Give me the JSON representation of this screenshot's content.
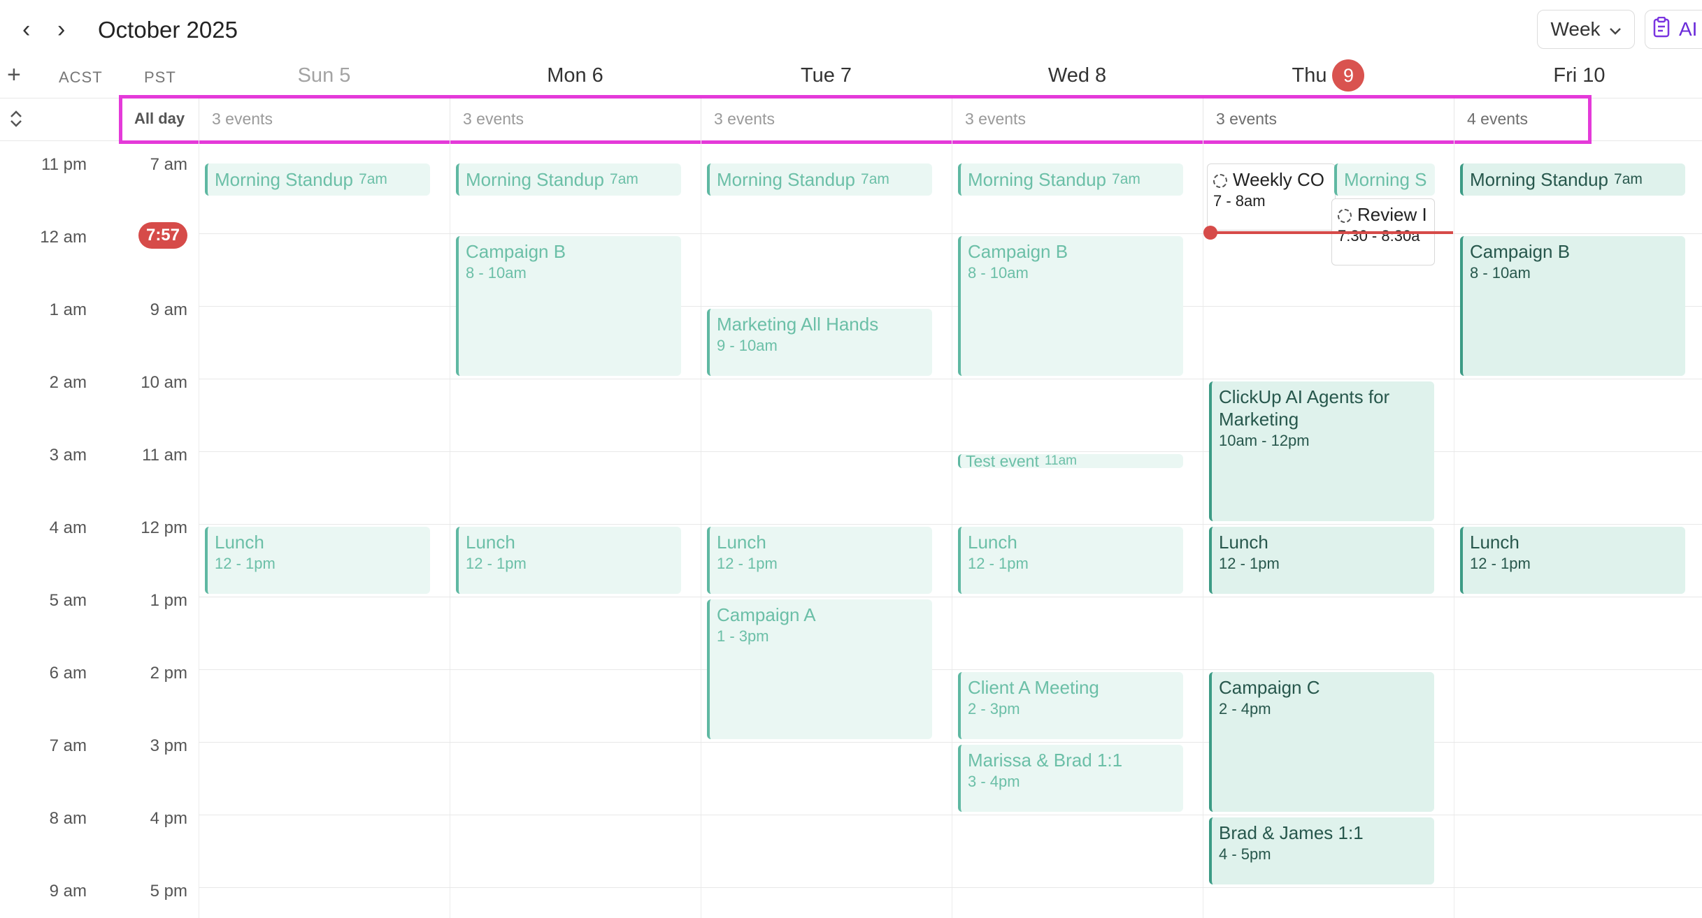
{
  "toolbar": {
    "prev_label": "‹",
    "next_label": "›",
    "month_title": "October 2025",
    "view_label": "Week",
    "ai_label": "AI"
  },
  "timezones": {
    "add_label": "+",
    "primary": "ACST",
    "secondary": "PST"
  },
  "days": [
    {
      "label": "Sun 5",
      "state": "past",
      "allday": "3 events"
    },
    {
      "label": "Mon 6",
      "state": "normal",
      "allday": "3 events"
    },
    {
      "label": "Tue 7",
      "state": "normal",
      "allday": "3 events"
    },
    {
      "label": "Wed 8",
      "state": "normal",
      "allday": "3 events"
    },
    {
      "label": "Thu",
      "badge": "9",
      "state": "today",
      "allday": "3 events"
    },
    {
      "label": "Fri 10",
      "state": "normal",
      "allday": "4 events"
    }
  ],
  "allday_label": "All day",
  "now_time": "7:57",
  "time_rows": [
    {
      "acst": "11 pm",
      "pst": "7 am"
    },
    {
      "acst": "12 am",
      "pst": ""
    },
    {
      "acst": "1 am",
      "pst": "9 am"
    },
    {
      "acst": "2 am",
      "pst": "10 am"
    },
    {
      "acst": "3 am",
      "pst": "11 am"
    },
    {
      "acst": "4 am",
      "pst": "12 pm"
    },
    {
      "acst": "5 am",
      "pst": "1 pm"
    },
    {
      "acst": "6 am",
      "pst": "2 pm"
    },
    {
      "acst": "7 am",
      "pst": "3 pm"
    },
    {
      "acst": "8 am",
      "pst": "4 pm"
    },
    {
      "acst": "9 am",
      "pst": "5 pm"
    }
  ],
  "events": {
    "sun": [
      {
        "title": "Morning Standup",
        "time": "7am"
      },
      {
        "title": "Lunch",
        "time": "12 - 1pm"
      }
    ],
    "mon": [
      {
        "title": "Morning Standup",
        "time": "7am"
      },
      {
        "title": "Campaign B",
        "time": "8 - 10am"
      },
      {
        "title": "Lunch",
        "time": "12 - 1pm"
      }
    ],
    "tue": [
      {
        "title": "Morning Standup",
        "time": "7am"
      },
      {
        "title": "Marketing All Hands",
        "time": "9 - 10am"
      },
      {
        "title": "Lunch",
        "time": "12 - 1pm"
      },
      {
        "title": "Campaign A",
        "time": "1 - 3pm"
      }
    ],
    "wed": [
      {
        "title": "Morning Standup",
        "time": "7am"
      },
      {
        "title": "Campaign B",
        "time": "8 - 10am"
      },
      {
        "title": "Test event",
        "time": "11am"
      },
      {
        "title": "Lunch",
        "time": "12 - 1pm"
      },
      {
        "title": "Client A Meeting",
        "time": "2 - 3pm"
      },
      {
        "title": "Marissa & Brad 1:1",
        "time": "3 - 4pm"
      }
    ],
    "thu": [
      {
        "title": "Weekly CO",
        "time": "7 - 8am"
      },
      {
        "title": "Morning S",
        "time": ""
      },
      {
        "title": "Review I",
        "time": "7:30 - 8:30a"
      },
      {
        "title": "ClickUp AI Agents for Marketing",
        "time": "10am - 12pm"
      },
      {
        "title": "Lunch",
        "time": "12 - 1pm"
      },
      {
        "title": "Campaign C",
        "time": "2 - 4pm"
      },
      {
        "title": "Brad & James 1:1",
        "time": "4 - 5pm"
      }
    ],
    "fri": [
      {
        "title": "Morning Standup",
        "time": "7am"
      },
      {
        "title": "Campaign B",
        "time": "8 - 10am"
      },
      {
        "title": "Lunch",
        "time": "12 - 1pm"
      }
    ]
  },
  "colors": {
    "today_accent": "#d9534f",
    "event_bg": "#eaf7f3",
    "event_border": "#5fb8a2",
    "highlight": "#e43ad9"
  }
}
